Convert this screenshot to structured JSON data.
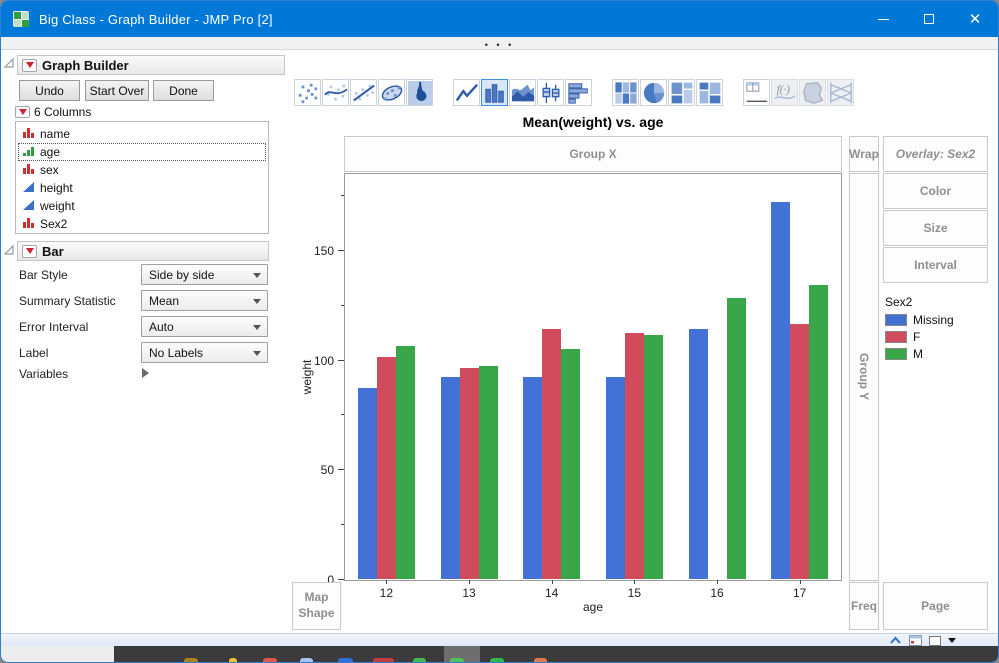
{
  "window": {
    "title": "Big Class - Graph Builder - JMP Pro [2]",
    "overflow_dots": "• • •"
  },
  "left_panel": {
    "report_title": "Graph Builder",
    "buttons": [
      "Undo",
      "Start Over",
      "Done"
    ],
    "columns_header": "6 Columns",
    "columns": [
      {
        "name": "name",
        "type": "nominal",
        "selected": false
      },
      {
        "name": "age",
        "type": "ordinal",
        "selected": true
      },
      {
        "name": "sex",
        "type": "nominal",
        "selected": false
      },
      {
        "name": "height",
        "type": "continuous",
        "selected": false
      },
      {
        "name": "weight",
        "type": "continuous",
        "selected": false
      },
      {
        "name": "Sex2",
        "type": "nominal",
        "selected": false
      }
    ],
    "section_title": "Bar",
    "properties": [
      {
        "label": "Bar Style",
        "value": "Side by side"
      },
      {
        "label": "Summary Statistic",
        "value": "Mean"
      },
      {
        "label": "Error Interval",
        "value": "Auto"
      },
      {
        "label": "Label",
        "value": "No Labels"
      },
      {
        "label": "Variables",
        "value": ""
      }
    ]
  },
  "toolbar": {
    "icons": [
      {
        "name": "scatter"
      },
      {
        "name": "smoother"
      },
      {
        "name": "line-of-fit"
      },
      {
        "name": "ellipse"
      },
      {
        "name": "contour",
        "group_end": true
      },
      {
        "name": "line"
      },
      {
        "name": "bar",
        "selected": true
      },
      {
        "name": "area"
      },
      {
        "name": "box-plot"
      },
      {
        "name": "histogram",
        "group_end": true
      },
      {
        "name": "heatmap"
      },
      {
        "name": "pie"
      },
      {
        "name": "treemap"
      },
      {
        "name": "mosaic",
        "group_end": true
      },
      {
        "name": "caption-box"
      },
      {
        "name": "formula",
        "disabled": true
      },
      {
        "name": "map-shape",
        "disabled": true
      },
      {
        "name": "parallel",
        "disabled": true
      }
    ]
  },
  "drop_zones": {
    "group_x": "Group X",
    "wrap": "Wrap",
    "overlay": "Overlay: Sex2",
    "color": "Color",
    "size": "Size",
    "interval": "Interval",
    "group_y": "Group Y",
    "map_shape": "Map Shape",
    "freq": "Freq",
    "page": "Page"
  },
  "chart_data": {
    "type": "bar",
    "title": "Mean(weight) vs. age",
    "xlabel": "age",
    "ylabel": "weight",
    "categories": [
      "12",
      "13",
      "14",
      "15",
      "16",
      "17"
    ],
    "series": [
      {
        "name": "Missing",
        "color": "#4471d6",
        "values": [
          87,
          92,
          92,
          92,
          114,
          172
        ]
      },
      {
        "name": "F",
        "color": "#d04b5b",
        "values": [
          101,
          96,
          114,
          112,
          null,
          116
        ]
      },
      {
        "name": "M",
        "color": "#3aa64a",
        "values": [
          106,
          97,
          105,
          111,
          128,
          134
        ]
      }
    ],
    "ylim": [
      0,
      185
    ],
    "yticks": [
      0,
      50,
      100,
      150
    ],
    "yticks_minor": [
      25,
      75,
      125,
      175
    ],
    "legend_title": "Sex2",
    "legend_position": "right",
    "grid": false
  },
  "taskbar": {
    "icons": [
      {
        "name": "app-1",
        "color": "#a5831f",
        "x": 183,
        "w": 14
      },
      {
        "name": "app-2",
        "color": "#f2c233",
        "x": 228,
        "w": 8
      },
      {
        "name": "app-3",
        "color": "#e2574e",
        "x": 262,
        "w": 14
      },
      {
        "name": "app-4",
        "color": "#a6c4ee",
        "x": 299,
        "w": 13
      },
      {
        "name": "app-5",
        "color": "#2f6fd6",
        "x": 337,
        "w": 15
      },
      {
        "name": "app-6",
        "color": "#c23d3d",
        "x": 372,
        "w": 21
      },
      {
        "name": "app-7",
        "color": "#44b84e",
        "x": 412,
        "w": 13
      },
      {
        "name": "app-8",
        "color": "#52c15c",
        "x": 449,
        "w": 14
      },
      {
        "name": "app-9",
        "color": "#2cb84c",
        "x": 489,
        "w": 14
      },
      {
        "name": "app-10",
        "color": "#e07a52",
        "x": 533,
        "w": 13
      }
    ]
  }
}
